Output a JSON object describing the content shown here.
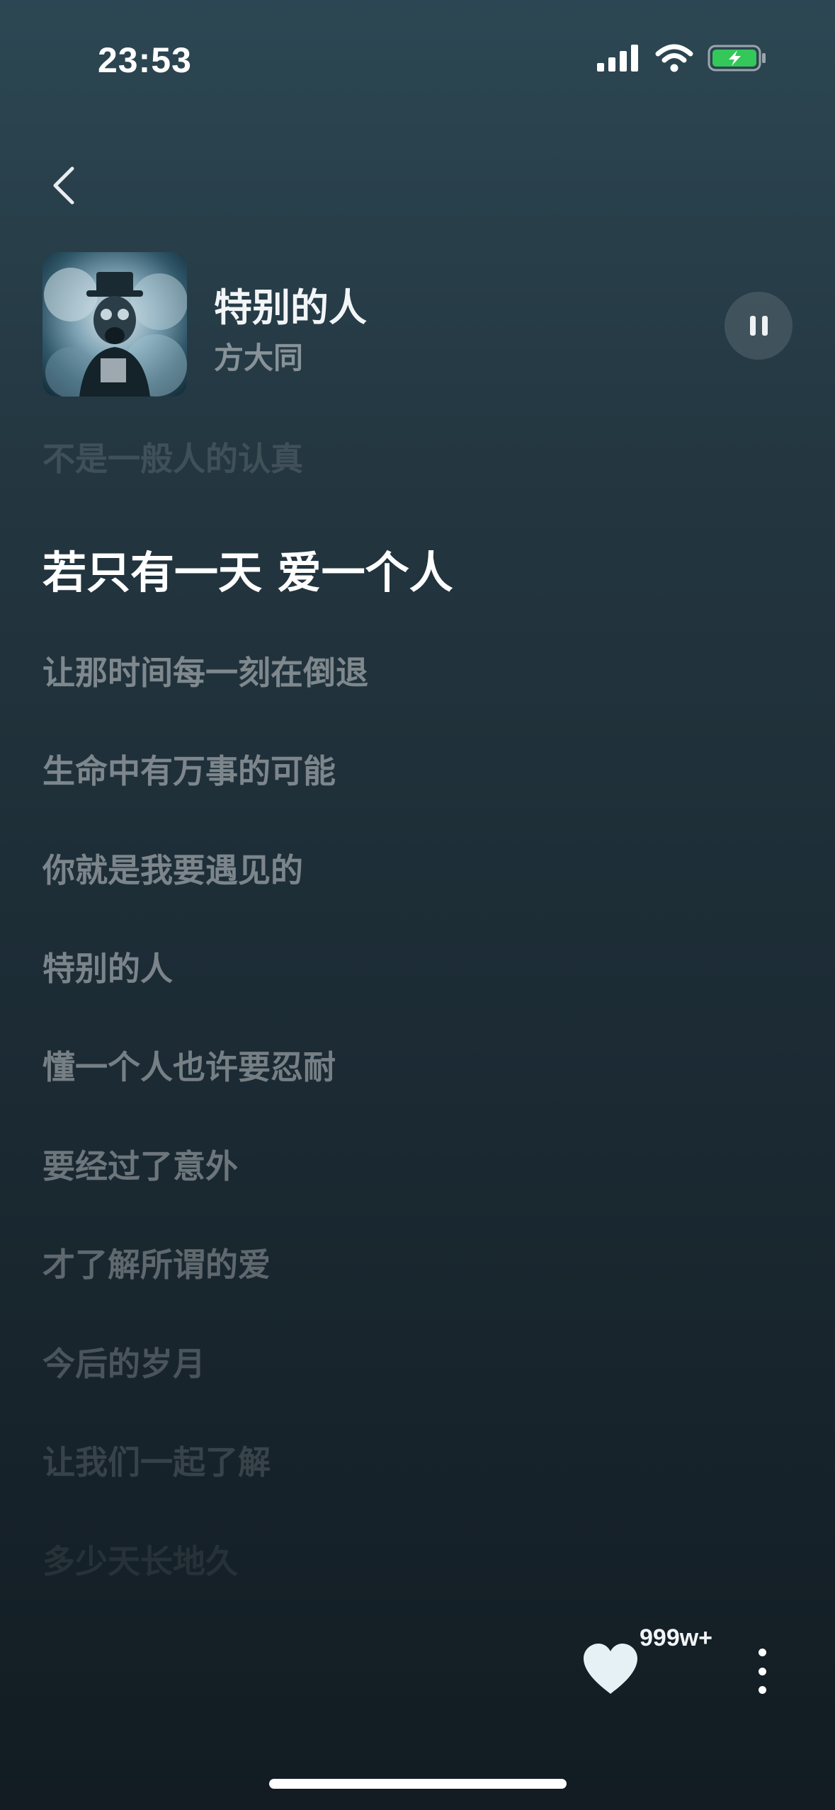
{
  "status_bar": {
    "time": "23:53",
    "signal_icon": "cellular-signal-icon",
    "wifi_icon": "wifi-icon",
    "battery_icon": "battery-charging-icon",
    "battery_color": "#34c759"
  },
  "header": {
    "back_icon": "chevron-left-icon"
  },
  "song": {
    "title": "特别的人",
    "artist": "方大同"
  },
  "controls": {
    "pause_icon": "pause-icon"
  },
  "lyrics": [
    {
      "text": "不是一般人的认真",
      "state": "past"
    },
    {
      "text": "若只有一天 爱一个人",
      "state": "current"
    },
    {
      "text": "让那时间每一刻在倒退",
      "state": "upcoming"
    },
    {
      "text": "生命中有万事的可能",
      "state": "upcoming"
    },
    {
      "text": "你就是我要遇见的",
      "state": "upcoming"
    },
    {
      "text": "特别的人",
      "state": "upcoming"
    },
    {
      "text": "懂一个人也许要忍耐",
      "state": "upcoming"
    },
    {
      "text": "要经过了意外",
      "state": "upcoming"
    },
    {
      "text": "才了解所谓的爱",
      "state": "upcoming"
    },
    {
      "text": "今后的岁月",
      "state": "fading"
    },
    {
      "text": "让我们一起了解",
      "state": "fading"
    },
    {
      "text": "多少天长地久",
      "state": "fading"
    }
  ],
  "footer": {
    "like_icon": "heart-icon",
    "like_count": "999w+",
    "more_icon": "more-vertical-icon"
  }
}
